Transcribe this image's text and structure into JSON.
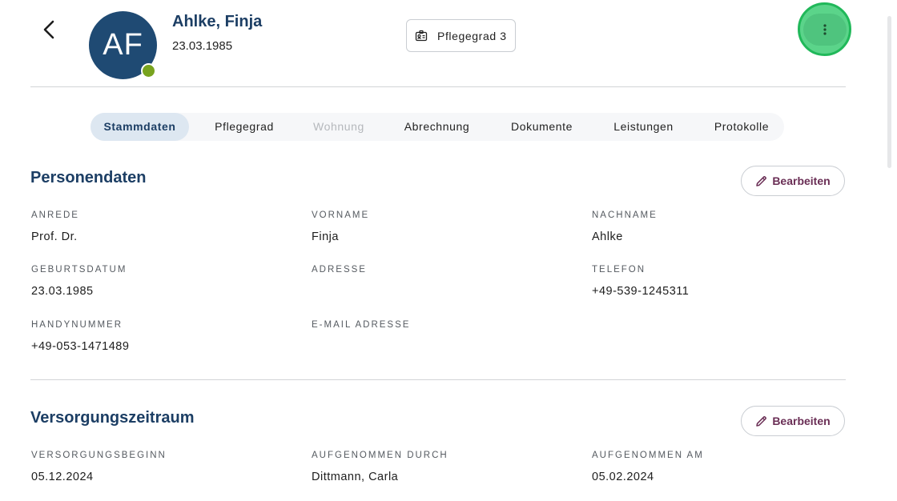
{
  "header": {
    "avatar_initials": "AF",
    "name": "Ahlke, Finja",
    "dob": "23.03.1985",
    "care_level_chip": "Pflegegrad 3"
  },
  "tabs": [
    {
      "label": "Stammdaten",
      "state": "active"
    },
    {
      "label": "Pflegegrad",
      "state": "normal"
    },
    {
      "label": "Wohnung",
      "state": "disabled"
    },
    {
      "label": "Abrechnung",
      "state": "normal"
    },
    {
      "label": "Dokumente",
      "state": "normal"
    },
    {
      "label": "Leistungen",
      "state": "normal"
    },
    {
      "label": "Protokolle",
      "state": "normal"
    }
  ],
  "personal": {
    "title": "Personendaten",
    "edit_label": "Bearbeiten",
    "fields": [
      {
        "label": "ANREDE",
        "value": "Prof. Dr."
      },
      {
        "label": "VORNAME",
        "value": "Finja"
      },
      {
        "label": "NACHNAME",
        "value": "Ahlke"
      },
      {
        "label": "GEBURTSDATUM",
        "value": "23.03.1985"
      },
      {
        "label": "ADRESSE",
        "value": ""
      },
      {
        "label": "TELEFON",
        "value": "+49-539-1245311"
      },
      {
        "label": "HANDYNUMMER",
        "value": "+49-053-1471489"
      },
      {
        "label": "E-MAIL ADRESSE",
        "value": ""
      }
    ]
  },
  "care_period": {
    "title": "Versorgungszeitraum",
    "edit_label": "Bearbeiten",
    "fields": [
      {
        "label": "VERSORGUNGSBEGINN",
        "value": "05.12.2024"
      },
      {
        "label": "AUFGENOMMEN DURCH",
        "value": "Dittmann, Carla"
      },
      {
        "label": "AUFGENOMMEN AM",
        "value": "05.02.2024"
      }
    ]
  },
  "colors": {
    "primary": "#1c3e64",
    "avatar": "#1f4a73",
    "status_online": "#78a31e",
    "edit_text": "#6a2e55",
    "highlight": "#21b85a"
  }
}
